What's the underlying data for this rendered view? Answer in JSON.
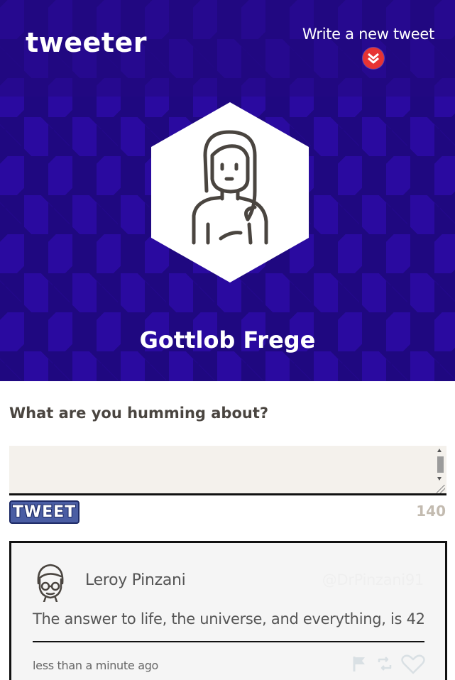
{
  "header": {
    "logo": "tweeter",
    "compose_link": "Write a new tweet",
    "compose_icon": "double-chevron-down-icon",
    "accent_color": "#e73333"
  },
  "profile": {
    "name": "Gottlob Frege",
    "avatar_icon": "woman-avatar-icon",
    "banner_color": "#2a0aa0"
  },
  "compose": {
    "prompt": "What are you humming about?",
    "textarea_value": "",
    "button_label": "TWEET",
    "char_count": "140"
  },
  "tweets": [
    {
      "author": "Leroy Pinzani",
      "handle": "@DrPinzani91",
      "text": "The answer to life, the universe, and everything, is 42",
      "time": "less than a minute ago",
      "avatar_icon": "man-with-glasses-avatar-icon",
      "actions": [
        "flag-icon",
        "retweet-icon",
        "heart-icon"
      ]
    }
  ]
}
